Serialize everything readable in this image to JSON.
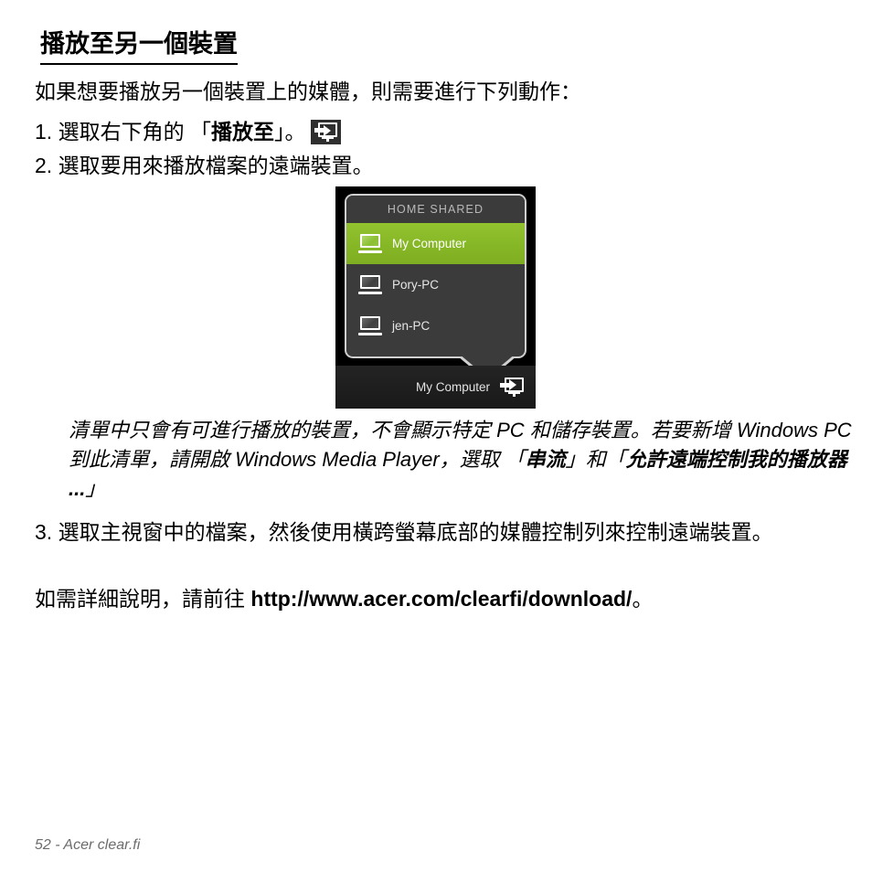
{
  "document": {
    "heading": "播放至另一個裝置",
    "intro": "如果想要播放另一個裝置上的媒體，則需要進行下列動作：",
    "steps": [
      {
        "number": "1.",
        "text_before": "選取右下角的 「",
        "bold": "播放至",
        "text_after": "」。",
        "icon": "play-to-icon"
      },
      {
        "number": "2.",
        "text": "選取要用來播放檔案的遠端裝置。"
      },
      {
        "number": "3.",
        "text": "選取主視窗中的檔案，然後使用橫跨螢幕底部的媒體控制列來控制遠端裝置。"
      }
    ],
    "note": {
      "part1": "清單中只會有可進行播放的裝置，不會顯示特定 PC 和儲存裝置。若要新增 Windows PC 到此清單，請開啟 Windows Media Player，選取 「",
      "bold1": "串流",
      "part2": "」和「",
      "bold2": "允許遠端控制我的播放器 ...",
      "part3": "」"
    },
    "url_line": {
      "prefix": "如需詳細說明，請前往 ",
      "url": "http://www.acer.com/clearfi/download/",
      "suffix": "。"
    },
    "footer": "52 - Acer clear.fi"
  },
  "widget": {
    "popup_header": "HOME SHARED",
    "devices": [
      {
        "label": "My Computer",
        "selected": true,
        "icon": "laptop-icon"
      },
      {
        "label": "Pory-PC",
        "selected": false,
        "icon": "laptop-icon"
      },
      {
        "label": "jen-PC",
        "selected": false,
        "icon": "laptop-icon"
      }
    ],
    "bottom_bar": {
      "label": "My Computer",
      "icon": "play-to-icon"
    },
    "colors": {
      "selected_green": "#86b726",
      "panel_dark": "#3b3b3b",
      "bar_dark": "#1d1d1d",
      "border_light": "#cfcfcf",
      "frame_black": "#000000"
    }
  }
}
